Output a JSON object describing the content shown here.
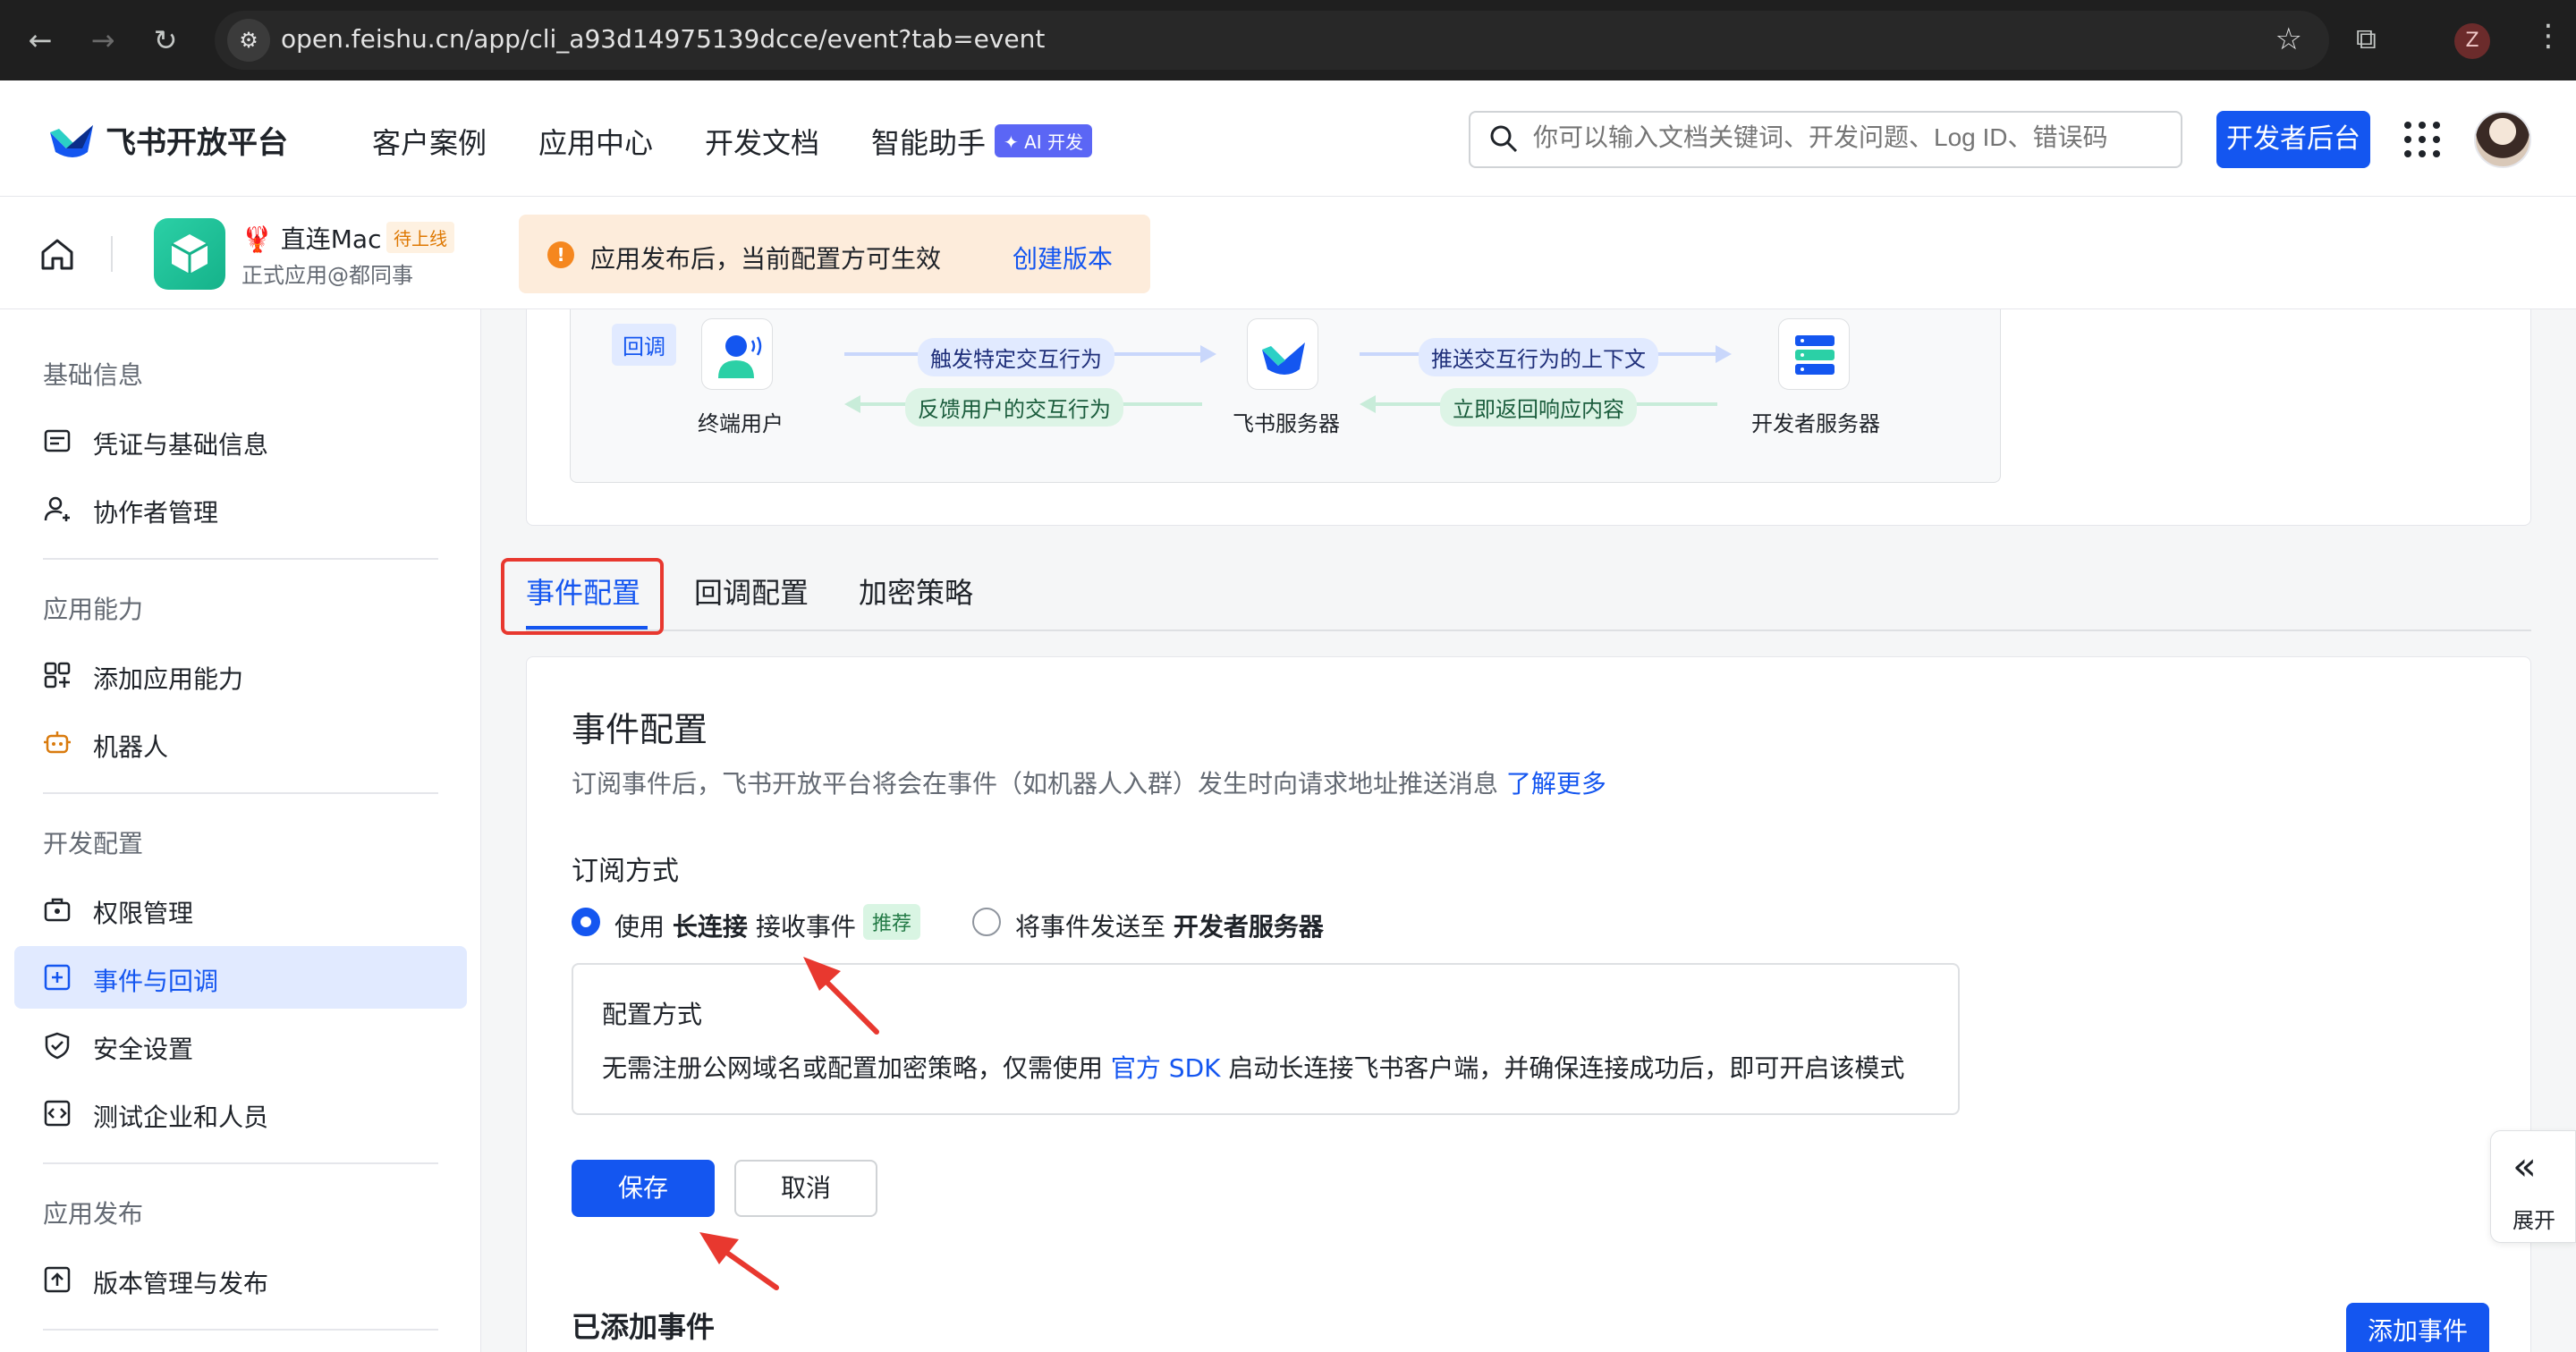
{
  "browser": {
    "url": "open.feishu.cn/app/cli_a93d14975139dcce/event?tab=event",
    "profile_initial": "Z",
    "icons": [
      "back-icon",
      "forward-icon",
      "reload-icon",
      "site-info-icon",
      "bookmark-star-icon",
      "extensions-icon",
      "chrome-menu-icon"
    ]
  },
  "topnav": {
    "logo_text": "飞书开放平台",
    "items": [
      "客户案例",
      "应用中心",
      "开发文档",
      "智能助手"
    ],
    "ai_badge": "✦ AI 开发",
    "search_placeholder": "你可以输入文档关键词、开发问题、Log ID、错误码",
    "console_button": "开发者后台"
  },
  "app_header": {
    "app_name": "🦞 直连Mac",
    "status": "待上线",
    "subtitle": "正式应用@都同事",
    "notice_icon": "!",
    "notice_text": "应用发布后，当前配置方可生效",
    "notice_link": "创建版本"
  },
  "sidebar": {
    "groups": [
      {
        "title": "基础信息",
        "items": [
          "凭证与基础信息",
          "协作者管理"
        ]
      },
      {
        "title": "应用能力",
        "items": [
          "添加应用能力",
          "机器人"
        ]
      },
      {
        "title": "开发配置",
        "items": [
          "权限管理",
          "事件与回调",
          "安全设置",
          "测试企业和人员"
        ]
      },
      {
        "title": "应用发布",
        "items": [
          "版本管理与发布"
        ]
      }
    ],
    "active_item": "事件与回调"
  },
  "diagram": {
    "tag": "回调",
    "nodes": [
      "终端用户",
      "飞书服务器",
      "开发者服务器"
    ],
    "flows": [
      "触发特定交互行为",
      "反馈用户的交互行为",
      "推送交互行为的上下文",
      "立即返回响应内容"
    ]
  },
  "tabs": [
    "事件配置",
    "回调配置",
    "加密策略"
  ],
  "config": {
    "title": "事件配置",
    "desc": "订阅事件后，飞书开放平台将会在事件（如机器人入群）发生时向请求地址推送消息",
    "learn_more": "了解更多",
    "subscribe_title": "订阅方式",
    "option_ws_pre": "使用 ",
    "option_ws_bold": "长连接",
    "option_ws_post": " 接收事件",
    "recommend": "推荐",
    "option_http_pre": "将事件发送至 ",
    "option_http_bold": "开发者服务器",
    "mode_title": "配置方式",
    "mode_desc_pre": "无需注册公网域名或配置加密策略，仅需使用 ",
    "mode_desc_link": "官方 SDK",
    "mode_desc_post": " 启动长连接飞书客户端，并确保连接成功后，即可开启该模式",
    "save": "保存",
    "cancel": "取消",
    "added_title": "已添加事件",
    "add_event": "添加事件"
  },
  "expand": {
    "icon": "«",
    "label": "展开"
  },
  "colors": {
    "primary": "#1456f0",
    "annotation_red": "#e8382f",
    "sidebar_active_bg": "#e1eaff"
  }
}
